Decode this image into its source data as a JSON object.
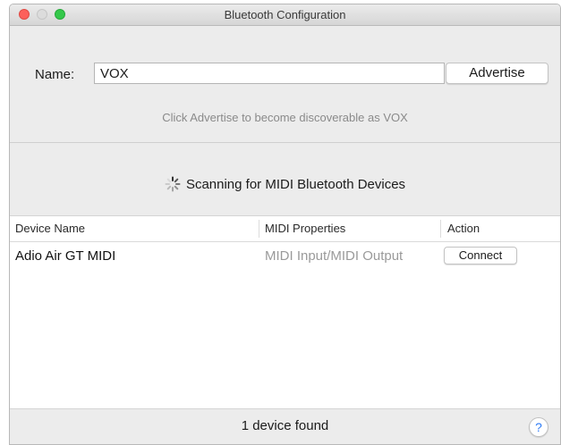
{
  "window": {
    "title": "Bluetooth Configuration"
  },
  "advertise": {
    "name_label": "Name:",
    "name_value": "VOX",
    "button_label": "Advertise",
    "hint": "Click Advertise to become discoverable as VOX"
  },
  "scan": {
    "status": "Scanning for MIDI Bluetooth Devices",
    "icon": "spinner-icon"
  },
  "table": {
    "columns": [
      "Device Name",
      "MIDI Properties",
      "Action"
    ],
    "rows": [
      {
        "device": "Adio Air GT MIDI",
        "properties": "MIDI Input/MIDI Output",
        "action": "Connect"
      }
    ]
  },
  "footer": {
    "status": "1 device found",
    "help_label": "?"
  },
  "colors": {
    "close": "#fc605b",
    "zoom": "#34c84a",
    "help_accent": "#2f7cf6"
  }
}
